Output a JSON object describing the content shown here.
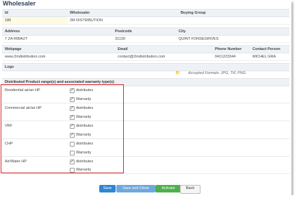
{
  "title": "Wholesaler",
  "row1": {
    "headers": [
      "Id",
      "Wholesaler",
      "Buying Group"
    ],
    "values": [
      "186",
      "2M DISTRIBUTION",
      ""
    ]
  },
  "row2": {
    "headers": [
      "Address",
      "Postcode",
      "City"
    ],
    "values": [
      "7 ZA RIBAUT",
      "31130",
      "QUINT FONSEGRIVES"
    ]
  },
  "row3": {
    "headers": [
      "Webpage",
      "Email",
      "Phone Number",
      "Contact Person"
    ],
    "values": [
      "www.2mdistribution.com",
      "contact@2mdistribution.com",
      "0411223344",
      "MICHEL GRA"
    ]
  },
  "logo": {
    "label": "Logo",
    "accepted_formats": "Accepted Formats: JPG, TIF, PNG."
  },
  "section_title": "Distributed Product range(s) and associated warranty type(s)",
  "products": [
    {
      "name": "Residential air/air HP",
      "distributes": true,
      "warranty": true
    },
    {
      "name": "Commercial air/air HP",
      "distributes": true,
      "warranty": true
    },
    {
      "name": "VRF",
      "distributes": true,
      "warranty": true
    },
    {
      "name": "CHP",
      "distributes": false,
      "warranty": false
    },
    {
      "name": "Air/Water HP",
      "distributes": true,
      "warranty": false
    }
  ],
  "checkbox_labels": {
    "distributes": "distributes",
    "warranty": "Warranty"
  },
  "buttons": {
    "save": "Save",
    "save_close": "Save and Close",
    "activate": "Activate",
    "back": "Back"
  },
  "icons": {
    "upload": "folder-icon"
  },
  "colors": {
    "save": "#2f86d4",
    "save_close": "#6fa8dc",
    "activate": "#4db04d",
    "highlight_box": "#d42a2a"
  }
}
